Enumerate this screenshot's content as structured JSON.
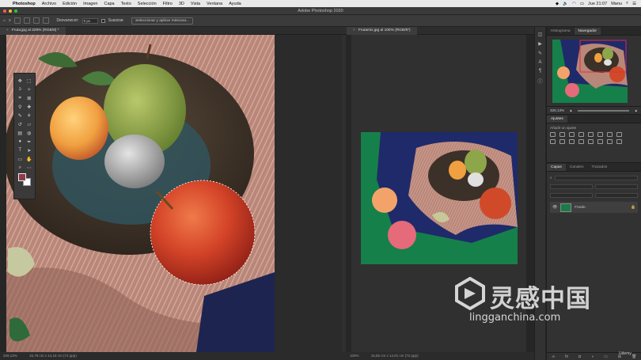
{
  "menubar": {
    "items": [
      "Photoshop",
      "Archivo",
      "Edición",
      "Imagen",
      "Capa",
      "Texto",
      "Selección",
      "Filtro",
      "3D",
      "Vista",
      "Ventana",
      "Ayuda"
    ],
    "clock": "Jue 21:07",
    "user": "Manu"
  },
  "window": {
    "title": "Adobe Photoshop 2020"
  },
  "options": {
    "feather_label": "Desvanecer:",
    "feather_value": "0 px",
    "antialias_label": "Suavizar",
    "mask_button": "Seleccionar y aplicar máscara..."
  },
  "documents": [
    {
      "tab": "Fruta.jpg al 329% (RGB/8) *",
      "status_zoom": "329,13%",
      "status_size": "15,79 cm x 14,18 cm (72 ppp)"
    },
    {
      "tab": "Frutamix.jpg al 100% (RGB/8*)",
      "status_zoom": "100%",
      "status_size": "15,56 cm x 14,01 cm (72 ppp)"
    }
  ],
  "navigator": {
    "tabs": [
      "Histograma",
      "Navegador"
    ],
    "zoom": "329,13%"
  },
  "adjustments": {
    "tab": "Ajustes",
    "hint": "Añadir un ajuste"
  },
  "layers": {
    "tabs": [
      "Capas",
      "Canales",
      "Trazados"
    ],
    "layer_name": "Fondo"
  },
  "watermark": {
    "cn": "灵感中国",
    "url": "lingganchina.com"
  },
  "udemy": "Udemy",
  "colors": {
    "foreground": "#8e3b47",
    "background": "#ffffff",
    "accent": "#1a7a4a"
  }
}
